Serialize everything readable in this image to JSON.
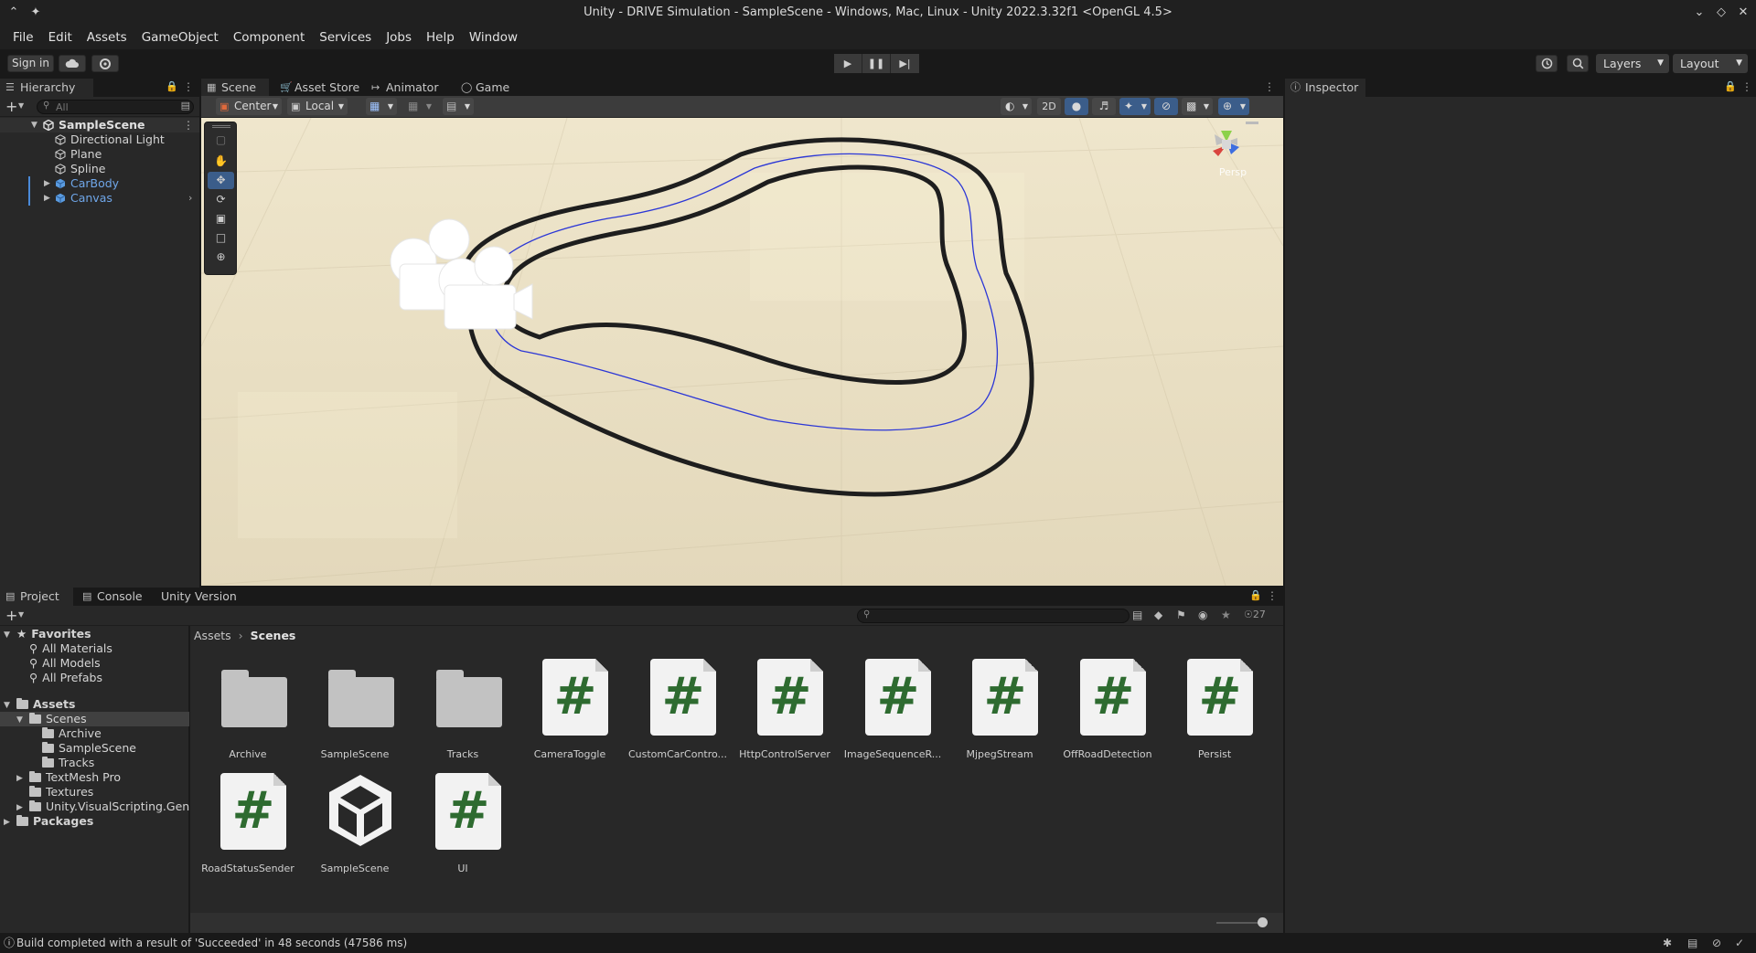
{
  "window": {
    "title": "Unity - DRIVE Simulation - SampleScene - Windows, Mac, Linux - Unity 2022.3.32f1 <OpenGL 4.5>"
  },
  "menu": [
    "File",
    "Edit",
    "Assets",
    "GameObject",
    "Component",
    "Services",
    "Jobs",
    "Help",
    "Window"
  ],
  "toolbar": {
    "sign_in": "Sign in",
    "layers": "Layers",
    "layout": "Layout"
  },
  "hierarchy": {
    "tab": "Hierarchy",
    "search_placeholder": "All",
    "scene": "SampleScene",
    "items": [
      "Directional Light",
      "Plane",
      "Spline",
      "CarBody",
      "Canvas"
    ]
  },
  "scene_tabs": [
    "Scene",
    "Asset Store",
    "Animator",
    "Game"
  ],
  "scene_toolbar": {
    "pivot": "Center",
    "space": "Local",
    "mode_2d": "2D"
  },
  "gizmo": {
    "projection": "Persp"
  },
  "inspector": {
    "tab": "Inspector"
  },
  "bottom_tabs": [
    "Project",
    "Console",
    "Unity Version Control"
  ],
  "project": {
    "hidden_count": "27",
    "breadcrumb": [
      "Assets",
      "Scenes"
    ],
    "favorites_label": "Favorites",
    "favorites": [
      "All Materials",
      "All Models",
      "All Prefabs"
    ],
    "assets_label": "Assets",
    "tree": [
      {
        "label": "Scenes",
        "indent": 1
      },
      {
        "label": "Archive",
        "indent": 2
      },
      {
        "label": "SampleScene",
        "indent": 2
      },
      {
        "label": "Tracks",
        "indent": 2
      },
      {
        "label": "TextMesh Pro",
        "indent": 1
      },
      {
        "label": "Textures",
        "indent": 1
      },
      {
        "label": "Unity.VisualScripting.Genera",
        "indent": 1
      }
    ],
    "packages_label": "Packages",
    "assets": [
      {
        "name": "Archive",
        "kind": "folder"
      },
      {
        "name": "SampleScene",
        "kind": "folder"
      },
      {
        "name": "Tracks",
        "kind": "folder"
      },
      {
        "name": "CameraToggle",
        "kind": "script"
      },
      {
        "name": "CustomCarContro...",
        "kind": "script"
      },
      {
        "name": "HttpControlServer",
        "kind": "script"
      },
      {
        "name": "ImageSequenceR...",
        "kind": "script"
      },
      {
        "name": "MjpegStream",
        "kind": "script"
      },
      {
        "name": "OffRoadDetection",
        "kind": "script"
      },
      {
        "name": "Persist",
        "kind": "script"
      },
      {
        "name": "RoadStatusSender",
        "kind": "script"
      },
      {
        "name": "SampleScene",
        "kind": "unity"
      },
      {
        "name": "UI",
        "kind": "script"
      }
    ]
  },
  "status": {
    "message": "Build completed with a result of 'Succeeded' in 48 seconds (47586 ms)"
  },
  "colors": {
    "accent": "#3b5d8a",
    "panel": "#282828",
    "script_hash": "#2e6b30",
    "selected_text": "#6fa6e8"
  }
}
